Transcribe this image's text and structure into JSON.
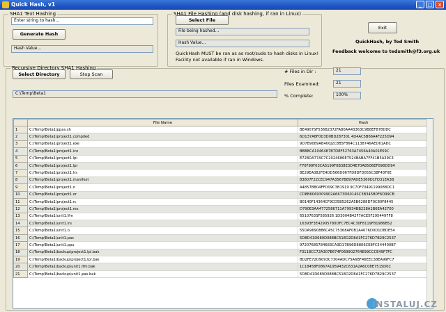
{
  "window": {
    "title": "Quick Hash, v1"
  },
  "text_hashing": {
    "legend": "SHA1 Text Hashing",
    "input_placeholder": "Enter string to hash...",
    "generate_button": "Generate Hash",
    "hash_value": "Hash Value..."
  },
  "file_hashing": {
    "legend": "SHA1 File Hashing (and disk hashing, if ran in Linux)",
    "select_button": "Select File",
    "file_being_hashed": "File being hashed...",
    "hash_value": "Hash Value...",
    "note_line1": "QuickHash MUST be ran as as root/sudo to hash disks in Linux!",
    "note_line2": "Facility not available if ran in Windows."
  },
  "about": {
    "exit_button": "Exit",
    "credit": "QuickHash, by Ted Smith",
    "feedback": "Feedback welcome to tedsmith@f3.org.uk"
  },
  "recursive": {
    "legend": "Recursive Directory SHA1  Hashing",
    "select_directory_button": "Select Directory",
    "stop_scan_button": "Stop Scan",
    "path": "C:\\Temp\\Beta1",
    "files_in_dir_label": "# Files in Dir :",
    "files_in_dir_value": "21",
    "files_examined_label": "Files Examined:",
    "files_examined_value": "21",
    "complete_label": "% Complete:",
    "complete_value": "100%"
  },
  "grid": {
    "columns": [
      "",
      "File Name",
      "Hash"
    ],
    "rows": [
      [
        "1",
        "C:\\Temp\\Beta1\\ppas.sh",
        "BE4907SF536B2372FA80AA43363C9B8EF878DDC"
      ],
      [
        "2",
        "C:\\Temp\\Beta1\\project1.compiled",
        "6D137A8F0D3D0BD287301 4D4AC5B66A4F225D94"
      ],
      [
        "3",
        "C:\\Temp\\Beta1\\project1.exe",
        "9D7B9089AB400J2C8B5F864C1138746AED61ADC"
      ],
      [
        "4",
        "C:\\Temp\\Beta1\\project1.ico",
        "BBB8CA1046487B7D8F52763A7456A40A01E59C"
      ],
      [
        "5",
        "C:\\Temp\\Beta1\\project1.lpi",
        "E728DA77AC7C2024686E7524BABA7FF41B5A39C3"
      ],
      [
        "6",
        "C:\\Temp\\Beta1\\project1.lpr",
        "F70F99F03CA5199F0B38E3D4E70A8506EF098DD94"
      ],
      [
        "7",
        "C:\\Temp\\Beta1\\project1.lrs",
        "8E29EA082FE4DD566D067FD8DFD055C38F43F0E"
      ],
      [
        "8",
        "C:\\Temp\\Beta1\\project1.manifest",
        "83807F22CEC947A3567B897ADE5360D1FD31EA3B"
      ],
      [
        "9",
        "C:\\Temp\\Beta1\\project1.o",
        "A4857BB04FFD09C3B1919 9C70F70491199088DC1"
      ],
      [
        "10",
        "C:\\Temp\\Beta1\\project1.or",
        "CD8B6069309902A6673D6014SC3B345B0F6D99CB"
      ],
      [
        "11",
        "C:\\Temp\\Beta1\\project1.rc",
        "B0140F14364CF9CD5B5262A5B6288D70C80F8445"
      ],
      [
        "12",
        "C:\\Temp\\Beta1\\project1.res",
        "D790E3AA4772586711A79934BB228A1B6EA42700"
      ],
      [
        "13",
        "C:\\Temp\\Beta1\\unit1.lfm",
        "6510763SF585926 1D3004B42F7ACE5F2954497F8"
      ],
      [
        "14",
        "C:\\Temp\\Beta1\\unit1.lrs",
        "16393F3E42905780DFC7EC4C30F8119F81986B52"
      ],
      [
        "15",
        "C:\\Temp\\Beta1\\unit1.o",
        "55DA9690886C45C75368AF0B1A4676D0D1D8DE54"
      ],
      [
        "16",
        "C:\\Temp\\Beta1\\unit1.pas",
        "5D8D41D689D088BC518D2D8A1FC276D7B29C2537"
      ],
      [
        "17",
        "C:\\Temp\\Beta1\\unit1.ppu",
        "97207685784683CA3D17B96D8806CE8FC544400B7"
      ],
      [
        "18",
        "C:\\Temp\\Beta1\\backup\\project1.lpi.bak",
        "F3118CC72A307E674F069902764E99CCCE49F7FC"
      ],
      [
        "19",
        "C:\\Temp\\Beta1\\backup\\project1.lpr.bak",
        "BD2FE72D9093C7304ADC75A6BF46EEC38EA99FC7"
      ],
      [
        "20",
        "C:\\Temp\\Beta1\\backup\\unit1.lfm.bak",
        "1C18458F0867A1959432C631A2A6C08E751SD0C"
      ],
      [
        "21",
        "C:\\Temp\\Beta1\\backup\\unit1.pas.bak",
        "5D8D41D689D088BC518D2D8A1FC276D7B29C2537"
      ]
    ]
  },
  "watermark": "INSTALUJ.CZ"
}
